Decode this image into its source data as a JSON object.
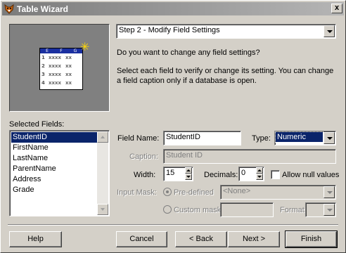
{
  "window": {
    "title": "Table Wizard",
    "close_glyph": "x",
    "app_icon": "fox-icon"
  },
  "preview": {
    "icon": "table-preview-icon",
    "columns": [
      "E",
      "F",
      "G"
    ],
    "rows": [
      {
        "n": "1",
        "a": "xxxx",
        "b": "xx"
      },
      {
        "n": "2",
        "a": "xxxx",
        "b": "xx"
      },
      {
        "n": "3",
        "a": "xxxx",
        "b": "xx"
      },
      {
        "n": "4",
        "a": "xxxx",
        "b": "xx"
      }
    ]
  },
  "step_select": {
    "value": "Step 2 - Modify Field Settings"
  },
  "instructions": {
    "question": "Do you want to change any field settings?",
    "detail": "Select each field to verify or change its setting. You can change a field caption only if a database is open."
  },
  "selected_fields": {
    "label": "Selected Fields:",
    "items": [
      "StudentID",
      "FirstName",
      "LastName",
      "ParentName",
      "Address",
      "Grade"
    ],
    "selected": "StudentID"
  },
  "field_name": {
    "label": "Field Name:",
    "value": "StudentID"
  },
  "type": {
    "label": "Type:",
    "value": "Numeric"
  },
  "caption": {
    "label": "Caption:",
    "value": "Student ID"
  },
  "width": {
    "label": "Width:",
    "value": "15"
  },
  "decimals": {
    "label": "Decimals:",
    "value": "0"
  },
  "allow_null": {
    "label": "Allow null values",
    "checked": false
  },
  "input_mask": {
    "label": "Input Mask:",
    "predefined_label": "Pre-defined",
    "predefined_value": "<None>",
    "custom_label": "Custom mask",
    "custom_value": "",
    "format_label": "Format:",
    "format_value": ""
  },
  "buttons": {
    "help": "Help",
    "cancel": "Cancel",
    "back": "< Back",
    "next": "Next >",
    "finish": "Finish"
  },
  "colors": {
    "selection": "#0a246a",
    "face": "#d4d0c8",
    "title_gradient_start": "#7b7b7b"
  }
}
